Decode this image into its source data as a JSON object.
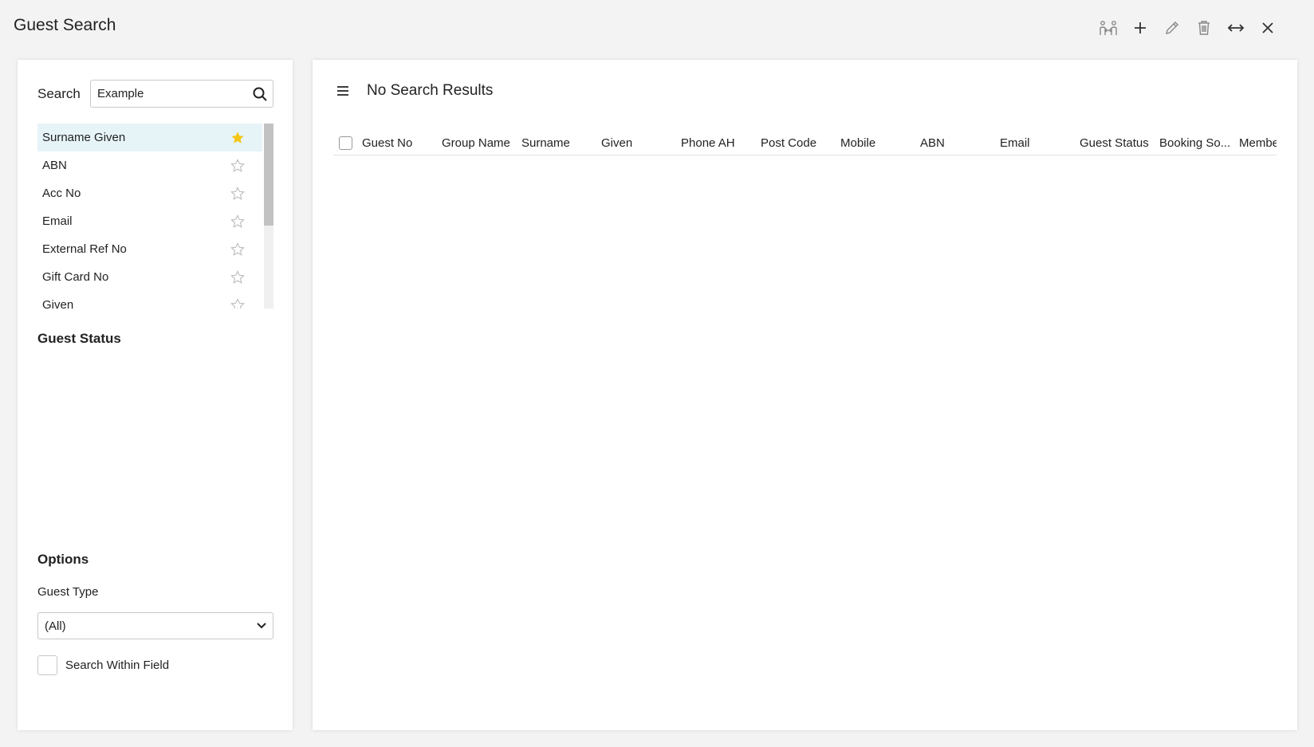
{
  "window": {
    "title": "Guest Search"
  },
  "toolbar": {
    "icons": [
      "group-icon",
      "plus-icon",
      "pencil-icon",
      "trash-icon",
      "expand-horizontal-icon",
      "close-icon"
    ]
  },
  "search": {
    "label": "Search",
    "value": "Example",
    "placeholder": ""
  },
  "fields": [
    {
      "label": "Surname Given",
      "favorite": true
    },
    {
      "label": "ABN",
      "favorite": false
    },
    {
      "label": "Acc No",
      "favorite": false
    },
    {
      "label": "Email",
      "favorite": false
    },
    {
      "label": "External Ref No",
      "favorite": false
    },
    {
      "label": "Gift Card No",
      "favorite": false
    },
    {
      "label": "Given",
      "favorite": false
    }
  ],
  "guest_status": {
    "title": "Guest Status"
  },
  "options": {
    "title": "Options",
    "guest_type_label": "Guest Type",
    "guest_type_value": "(All)",
    "search_within_label": "Search Within Field"
  },
  "results": {
    "title": "No Search Results",
    "columns": [
      "Guest No",
      "Group Name",
      "Surname",
      "Given",
      "Phone AH",
      "Post Code",
      "Mobile",
      "ABN",
      "Email",
      "Guest Status",
      "Booking So...",
      "Membe"
    ]
  },
  "colors": {
    "accent_star": "#f5c518",
    "selected_row": "#e6f4f8"
  }
}
